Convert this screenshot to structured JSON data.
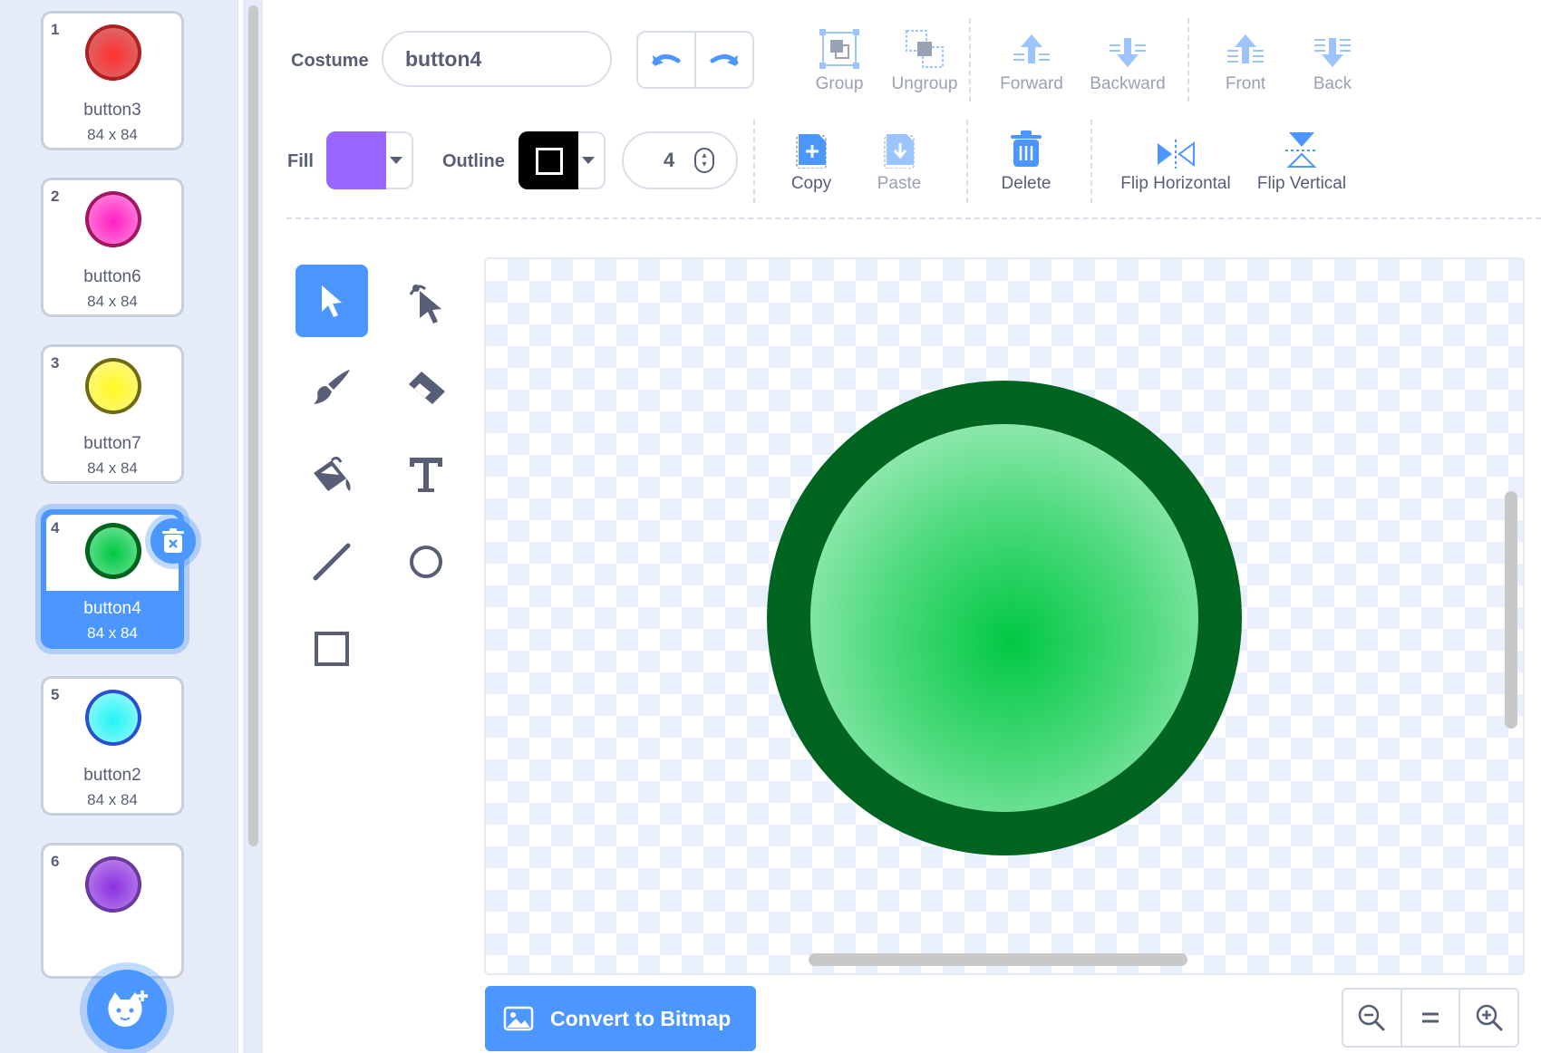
{
  "costumes": [
    {
      "num": "1",
      "name": "button3",
      "size": "84 x 84",
      "color": "#e03c3c"
    },
    {
      "num": "2",
      "name": "button6",
      "size": "84 x 84",
      "color": "#ff3ec8"
    },
    {
      "num": "3",
      "name": "button7",
      "size": "84 x 84",
      "color": "#fff53a"
    },
    {
      "num": "4",
      "name": "button4",
      "size": "84 x 84",
      "color": "#1fcf59",
      "selected": true
    },
    {
      "num": "5",
      "name": "button2",
      "size": "84 x 84",
      "color": "#3ef4f6"
    },
    {
      "num": "6",
      "name": "",
      "size": "",
      "color": "#9a4ee0"
    }
  ],
  "toolbar": {
    "costume_label": "Costume",
    "costume_name": "button4",
    "group": "Group",
    "ungroup": "Ungroup",
    "forward": "Forward",
    "backward": "Backward",
    "front": "Front",
    "back": "Back",
    "fill_label": "Fill",
    "fill_color": "#9966ff",
    "outline_label": "Outline",
    "outline_color": "#000000",
    "stroke_width": "4",
    "copy": "Copy",
    "paste": "Paste",
    "delete": "Delete",
    "flip_h": "Flip Horizontal",
    "flip_v": "Flip Vertical"
  },
  "canvas": {
    "shape_outline": "#006421",
    "shape_fill_center": "#00c843"
  },
  "bottom": {
    "convert": "Convert to Bitmap"
  },
  "accent": "#4c97ff"
}
